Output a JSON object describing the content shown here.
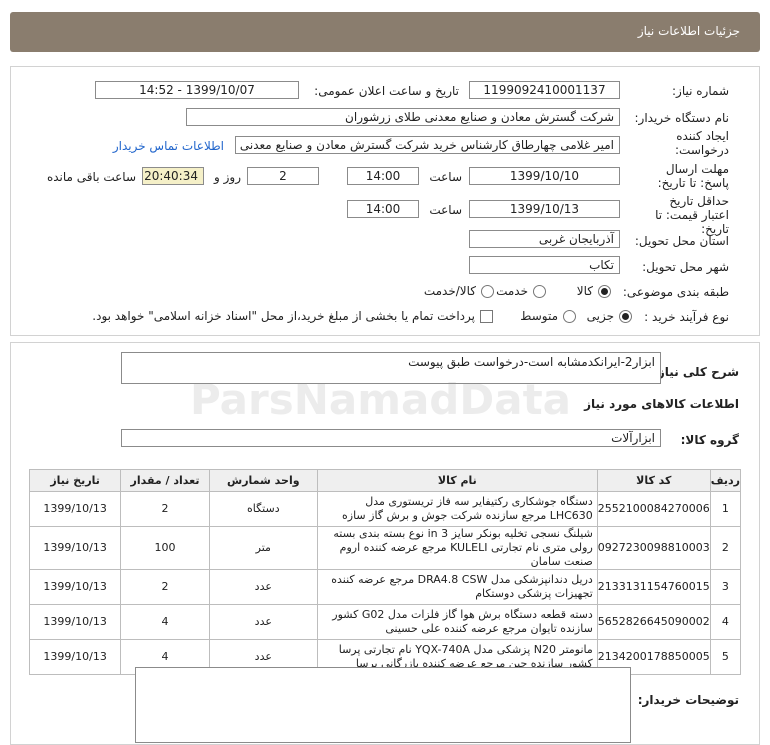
{
  "header": {
    "title": "جزئیات اطلاعات نیاز"
  },
  "need_info": {
    "need_number_label": "شماره نیاز:",
    "need_number": "1199092410001137",
    "announce_label": "تاریخ و ساعت اعلان عمومی:",
    "announce_value": "1399/10/07 - 14:52",
    "buyer_label": "نام دستگاه خریدار:",
    "buyer": "شرکت گسترش معادن و صنایع معدنی طلای زرشوران",
    "creator_label": "ایجاد کننده درخواست:",
    "creator": "امیر  غلامی چهارطاق کارشناس خرید شرکت گسترش معادن و صنایع معدنی ط",
    "contact_link": "اطلاعات تماس خریدار",
    "deadline_label": "مهلت ارسال پاسخ: تا تاریخ:",
    "deadline_date": "1399/10/10",
    "time_label": "ساعت",
    "deadline_time": "14:00",
    "days_value": "2",
    "days_label": "روز و",
    "remaining_value": "20:40:34",
    "remaining_label": "ساعت باقی مانده",
    "validity_label": "حداقل تاریخ اعتبار قیمت: تا تاریخ:",
    "validity_date": "1399/10/13",
    "validity_time": "14:00",
    "province_label": "استان محل تحویل:",
    "province": "آذربایجان غربی",
    "city_label": "شهر محل تحویل:",
    "city": "تکاب",
    "category_label": "طبقه بندی موضوعی:",
    "category_options": [
      "کالا",
      "خدمت",
      "کالا/خدمت"
    ],
    "process_label": "نوع فرآیند خرید :",
    "process_options": [
      "جزیی",
      "متوسط"
    ],
    "payment_note": "پرداخت تمام یا بخشی از مبلغ خرید،از محل \"اسناد خزانه اسلامی\" خواهد بود."
  },
  "summary": {
    "desc_label": "شرح کلی نیاز:",
    "desc": "ابزار2-ایرانکدمشابه است-درخواست طبق پیوست",
    "goods_heading": "اطلاعات کالاهای مورد نیاز",
    "group_label": "گروه کالا:",
    "group": "ابزارآلات",
    "buyer_notes_label": "توضیحات خریدار:",
    "watermark": "ParsNamadData"
  },
  "table": {
    "headers": [
      "ردیف",
      "کد کالا",
      "نام کالا",
      "واحد شمارش",
      "تعداد / مقدار",
      "تاریخ نیاز"
    ],
    "rows": [
      {
        "row": "1",
        "code": "2552100084270006",
        "name": "دستگاه جوشکاری رکتیفایر سه فاز تریستوری مدل LHC630 مرجع سازنده شرکت جوش و برش گاز سازه",
        "unit": "دستگاه",
        "qty": "2",
        "date": "1399/10/13"
      },
      {
        "row": "2",
        "code": "0927230098810003",
        "name": "شیلنگ نسجی تخلیه بونکر سایز in 3 نوع بسته بندی بسته رولی متری نام تجارتی KULELI مرجع عرضه کننده اروم صنعت سامان",
        "unit": "متر",
        "qty": "100",
        "date": "1399/10/13"
      },
      {
        "row": "3",
        "code": "2133131154760015",
        "name": "دریل دندانپزشکی مدل DRA4.8 CSW مرجع عرضه کننده تجهیزات پزشکی دوستکام",
        "unit": "عدد",
        "qty": "2",
        "date": "1399/10/13"
      },
      {
        "row": "4",
        "code": "5652826645090002",
        "name": "دسته قطعه دستگاه برش هوا گاز فلزات مدل G02 کشور سازنده تایوان مرجع عرضه کننده علی حسینی",
        "unit": "عدد",
        "qty": "4",
        "date": "1399/10/13"
      },
      {
        "row": "5",
        "code": "2134200178850005",
        "name": "مانومتر N20 پزشکی مدل YQX-740A نام تجارتی پرسا کشور سازنده چین مرجع عرضه کننده بازرگانی پرسا",
        "unit": "عدد",
        "qty": "4",
        "date": "1399/10/13"
      }
    ]
  }
}
